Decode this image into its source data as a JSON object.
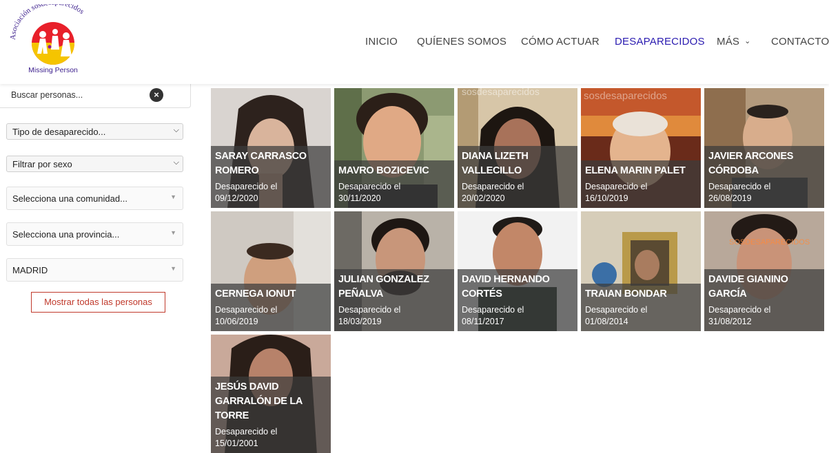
{
  "header": {
    "logo_arc_text": "Asociación sosdesaparecidos",
    "logo_caption": "Missing Person",
    "nav": [
      {
        "label": "INICIO",
        "active": false
      },
      {
        "label": "QUÍENES SOMOS",
        "active": false
      },
      {
        "label": "CÓMO ACTUAR",
        "active": false
      },
      {
        "label": "DESAPARECIDOS",
        "active": true
      },
      {
        "label": "MÁS",
        "active": false,
        "dropdown": true
      },
      {
        "label": "CONTACTO",
        "active": false
      }
    ]
  },
  "sidebar": {
    "search_value": "Buscar personas...",
    "filters": [
      {
        "label": "Tipo de desaparecido..."
      },
      {
        "label": "Filtrar por sexo"
      },
      {
        "label": "Selecciona una comunidad..."
      },
      {
        "label": "Selecciona una provincia..."
      },
      {
        "label": "MADRID"
      }
    ],
    "show_all_label": "Mostrar todas las personas"
  },
  "colors": {
    "accent": "#2a1bb0",
    "button_red": "#c0392b",
    "overlay": "#3c3c3c"
  },
  "people": [
    {
      "name": "SARAY CARRASCO ROMERO",
      "since": "Desaparecido el",
      "date": "09/12/2020"
    },
    {
      "name": "MAVRO BOZICEVIC",
      "since": "Desaparecido el",
      "date": "30/11/2020"
    },
    {
      "name": "DIANA LIZETH VALLECILLO",
      "since": "Desaparecido el",
      "date": "20/02/2020",
      "watermark": "sosdesaparecidos"
    },
    {
      "name": "ELENA MARIN PALET",
      "since": "Desaparecido el",
      "date": "16/10/2019",
      "watermark": "sosdesaparecidos"
    },
    {
      "name": "JAVIER ARCONES CÓRDOBA",
      "since": "Desaparecido el",
      "date": "26/08/2019"
    },
    {
      "name": "CERNEGA IONUT",
      "since": "Desaparecido el",
      "date": "10/06/2019"
    },
    {
      "name": "JULIAN GONZALEZ PEÑALVA",
      "since": "Desaparecido el",
      "date": "18/03/2019"
    },
    {
      "name": "DAVID HERNANDO CORTÉS",
      "since": "Desaparecido el",
      "date": "08/11/2017"
    },
    {
      "name": "TRAIAN BONDAR",
      "since": "Desaparecido el",
      "date": "01/08/2014"
    },
    {
      "name": "DAVIDE GIANINO GARCÍA",
      "since": "Desaparecido el",
      "date": "31/08/2012",
      "watermark": "SOSDESAPARECIDOS"
    },
    {
      "name": "JESÚS DAVID GARRALÓN DE LA TORRE",
      "since": "Desaparecido el",
      "date": "15/01/2001"
    }
  ]
}
